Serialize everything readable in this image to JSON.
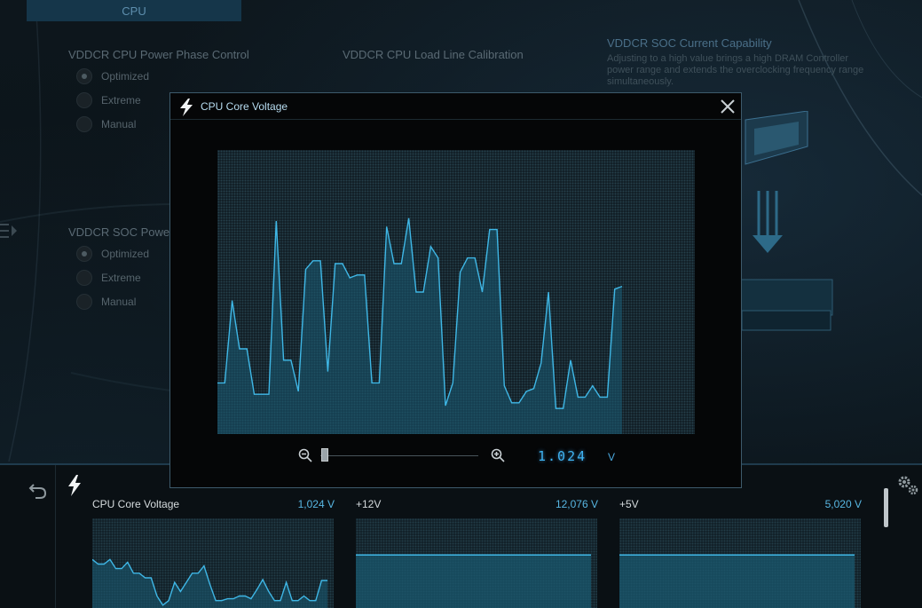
{
  "top_tab": {
    "label": "CPU"
  },
  "phase_control": {
    "title": "VDDCR CPU Power Phase Control",
    "options": [
      "Optimized",
      "Extreme",
      "Manual"
    ],
    "selected": "Optimized"
  },
  "load_line": {
    "title": "VDDCR CPU Load Line Calibration"
  },
  "soc_power": {
    "title": "VDDCR SOC Powe",
    "options": [
      "Optimized",
      "Extreme",
      "Manual"
    ],
    "selected": "Optimized"
  },
  "soc_current": {
    "title": "VDDCR SOC Current Capability",
    "description_lines": [
      "Adjusting to a high value brings a high DRAM Controller",
      "power range and extends the overclocking frequency range",
      "simultaneously."
    ]
  },
  "modal": {
    "title": "CPU Core Voltage",
    "value": "1.024",
    "unit": "V",
    "graph_series": [
      0.18,
      0.18,
      0.47,
      0.3,
      0.3,
      0.14,
      0.14,
      0.14,
      0.75,
      0.26,
      0.26,
      0.15,
      0.58,
      0.61,
      0.61,
      0.22,
      0.6,
      0.6,
      0.55,
      0.56,
      0.56,
      0.18,
      0.18,
      0.73,
      0.6,
      0.6,
      0.76,
      0.5,
      0.5,
      0.66,
      0.62,
      0.1,
      0.18,
      0.57,
      0.62,
      0.62,
      0.5,
      0.72,
      0.72,
      0.17,
      0.11,
      0.11,
      0.15,
      0.16,
      0.25,
      0.5,
      0.09,
      0.09,
      0.26,
      0.13,
      0.13,
      0.17,
      0.13,
      0.13,
      0.51,
      0.52
    ],
    "colors": {
      "line": "#3fb7e6",
      "fill": "#1a5b74",
      "value": "#3fb3f2"
    }
  },
  "bottom_bar": {
    "monitors": [
      {
        "label": "CPU Core Voltage",
        "value": "1,024 V",
        "series": [
          0.55,
          0.5,
          0.5,
          0.55,
          0.45,
          0.45,
          0.52,
          0.4,
          0.4,
          0.35,
          0.35,
          0.15,
          0.05,
          0.1,
          0.3,
          0.2,
          0.3,
          0.4,
          0.4,
          0.48,
          0.28,
          0.1,
          0.1,
          0.12,
          0.12,
          0.15,
          0.15,
          0.12,
          0.22,
          0.33,
          0.2,
          0.1,
          0.1,
          0.3,
          0.1,
          0.1,
          0.15,
          0.1,
          0.1,
          0.32,
          0.32
        ]
      },
      {
        "label": "+12V",
        "value": "12,076 V",
        "level": 0.6
      },
      {
        "label": "+5V",
        "value": "5,020 V",
        "level": 0.6
      }
    ]
  }
}
